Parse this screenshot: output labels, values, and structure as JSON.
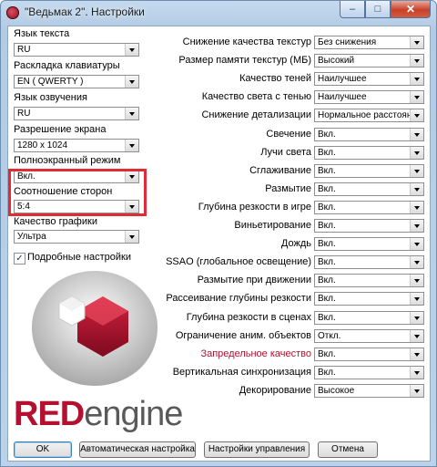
{
  "window": {
    "title": "\"Ведьмак 2\". Настройки",
    "min": "–",
    "max": "□",
    "close": "✕"
  },
  "left": {
    "language_text": {
      "label": "Язык текста",
      "value": "RU"
    },
    "keyboard": {
      "label": "Раскладка клавиатуры",
      "value": "EN ( QWERTY )"
    },
    "voice": {
      "label": "Язык озвучения",
      "value": "RU"
    },
    "resolution": {
      "label": "Разрешение экрана",
      "value": "1280 x 1024"
    },
    "fullscreen": {
      "label": "Полноэкранный режим",
      "value": "Вкл."
    },
    "aspect": {
      "label": "Соотношение сторон",
      "value": "5:4"
    },
    "quality": {
      "label": "Качество графики",
      "value": "Ультра"
    },
    "detailed": {
      "label": "Подробные настройки",
      "checked": true
    }
  },
  "logo": {
    "red": "RED",
    "engine": "engine"
  },
  "right": [
    {
      "label": "Снижение качества текстур",
      "value": "Без снижения"
    },
    {
      "label": "Размер памяти текстур (МБ)",
      "value": "Высокий"
    },
    {
      "label": "Качество теней",
      "value": "Наилучшее"
    },
    {
      "label": "Качество света с тенью",
      "value": "Наилучшее"
    },
    {
      "label": "Снижение детализации",
      "value": "Нормальное расстояние"
    },
    {
      "label": "Свечение",
      "value": "Вкл."
    },
    {
      "label": "Лучи света",
      "value": "Вкл."
    },
    {
      "label": "Сглаживание",
      "value": "Вкл."
    },
    {
      "label": "Размытие",
      "value": "Вкл."
    },
    {
      "label": "Глубина резкости в игре",
      "value": "Вкл."
    },
    {
      "label": "Виньетирование",
      "value": "Вкл."
    },
    {
      "label": "Дождь",
      "value": "Вкл."
    },
    {
      "label": "SSAO (глобальное освещение)",
      "value": "Вкл."
    },
    {
      "label": "Размытие при движении",
      "value": "Вкл."
    },
    {
      "label": "Рассеивание глубины резкости",
      "value": "Вкл."
    },
    {
      "label": "Глубина резкости в сценах",
      "value": "Вкл."
    },
    {
      "label": "Ограничение аним. объектов",
      "value": "Откл."
    },
    {
      "label": "Запредельное качество",
      "value": "Вкл.",
      "highlight_color": "#b3112f"
    },
    {
      "label": "Вертикальная синхронизация",
      "value": "Вкл."
    },
    {
      "label": "Декорирование",
      "value": "Высокое"
    }
  ],
  "buttons": {
    "ok": "OK",
    "auto": "Автоматическая настройка",
    "controls": "Настройки управления",
    "cancel": "Отмена"
  }
}
